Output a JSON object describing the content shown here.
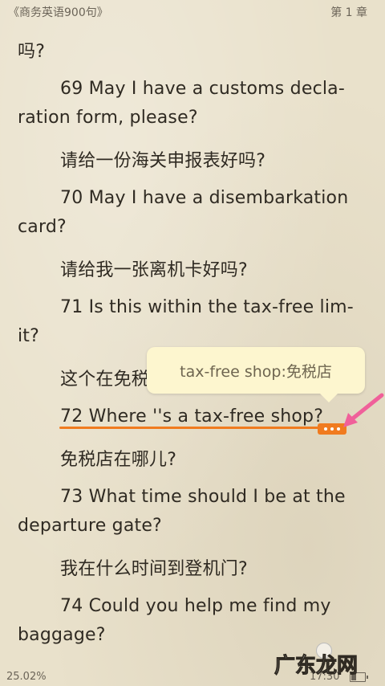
{
  "header": {
    "book_title": "《商务英语900句》",
    "chapter": "第 1 章"
  },
  "content": {
    "lines": [
      "吗?",
      "69 May I have a customs decla-",
      "ration form, please?",
      "请给一份海关申报表好吗?",
      "70 May I have a disembarkation",
      "card?",
      "请给我一张离机卡好吗?",
      "71 Is this within the tax-free lim-",
      "it?",
      "这个在免税",
      "72 Where ''s a tax-free shop?",
      "免税店在哪儿?",
      "73 What time should I be at the",
      "departure gate?",
      "我在什么时间到登机门?",
      "74 Could you help me find my",
      "baggage?"
    ]
  },
  "translation_popup": {
    "text": "tax-free shop:免税店"
  },
  "footer": {
    "progress": "25.02%",
    "time": "17:30",
    "watermark": "广东龙网"
  },
  "colors": {
    "highlight": "#f07b1f",
    "popup_bg": "#fdf6cf",
    "arrow": "#f0609a"
  },
  "icons": {
    "selection_handle": "ellipsis-handle-icon",
    "pointer": "pink-arrow-icon",
    "battery": "battery-icon"
  }
}
